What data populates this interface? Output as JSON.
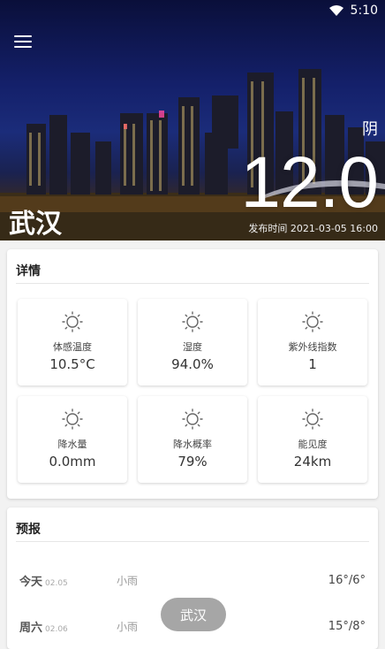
{
  "status_bar": {
    "time": "5:10",
    "wifi_icon": "wifi-icon"
  },
  "hero": {
    "city": "武汉",
    "condition": "阴",
    "temperature": "12.0",
    "publish_time": "发布时间 2021-03-05 16:00",
    "menu_icon": "menu-icon"
  },
  "details": {
    "title": "详情",
    "tiles": [
      {
        "icon": "sun-icon",
        "label": "体感温度",
        "value": "10.5°C"
      },
      {
        "icon": "sun-icon",
        "label": "湿度",
        "value": "94.0%"
      },
      {
        "icon": "sun-icon",
        "label": "紫外线指数",
        "value": "1"
      },
      {
        "icon": "sun-icon",
        "label": "降水量",
        "value": "0.0mm"
      },
      {
        "icon": "sun-icon",
        "label": "降水概率",
        "value": "79%"
      },
      {
        "icon": "sun-icon",
        "label": "能见度",
        "value": "24km"
      }
    ]
  },
  "forecast": {
    "title": "预报",
    "rows": [
      {
        "day": "今天",
        "date": "02.05",
        "condition": "小雨",
        "temp": "16°/6°"
      },
      {
        "day": "周六",
        "date": "02.06",
        "condition": "小雨",
        "temp": "15°/8°"
      }
    ]
  },
  "floating_button": {
    "label": "武汉"
  }
}
